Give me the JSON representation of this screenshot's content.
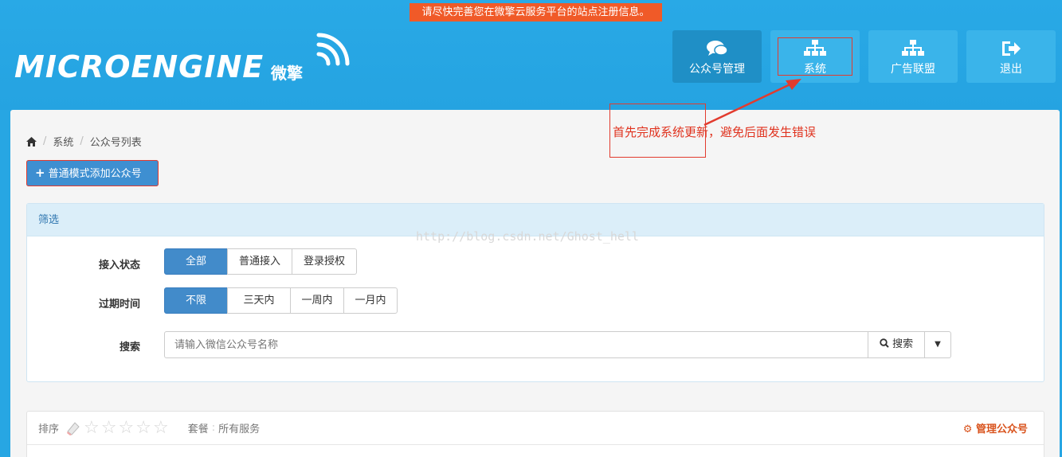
{
  "notice": "请尽快完善您在微擎云服务平台的站点注册信息。",
  "logo": {
    "text": "MICROENGINE",
    "cn": "微擎"
  },
  "nav": [
    {
      "label": "公众号管理",
      "icon": "comments-icon"
    },
    {
      "label": "系统",
      "icon": "sitemap-icon"
    },
    {
      "label": "广告联盟",
      "icon": "sitemap-icon"
    },
    {
      "label": "退出",
      "icon": "sign-out-icon"
    }
  ],
  "annotation": "首先完成系统更新，避免后面发生错误",
  "breadcrumb": {
    "home": "home-icon",
    "items": [
      "系统",
      "公众号列表"
    ]
  },
  "add_button": "普通模式添加公众号",
  "filter": {
    "title": "筛选",
    "access_label": "接入状态",
    "access_options": [
      "全部",
      "普通接入",
      "登录授权"
    ],
    "expire_label": "过期时间",
    "expire_options": [
      "不限",
      "三天内",
      "一周内",
      "一月内"
    ],
    "search_label": "搜索",
    "search_placeholder": "请输入微信公众号名称",
    "search_button": "搜索"
  },
  "watermark": "http://blog.csdn.net/Ghost_hell",
  "list": {
    "sort_label": "排序",
    "stars": 5,
    "package_label": "套餐",
    "package_value": "所有服务",
    "manage_label": "管理公众号"
  },
  "colors": {
    "header": "#27a6e3",
    "notice": "#f05a28",
    "primary": "#428bca",
    "annotation": "#e23b2e"
  }
}
